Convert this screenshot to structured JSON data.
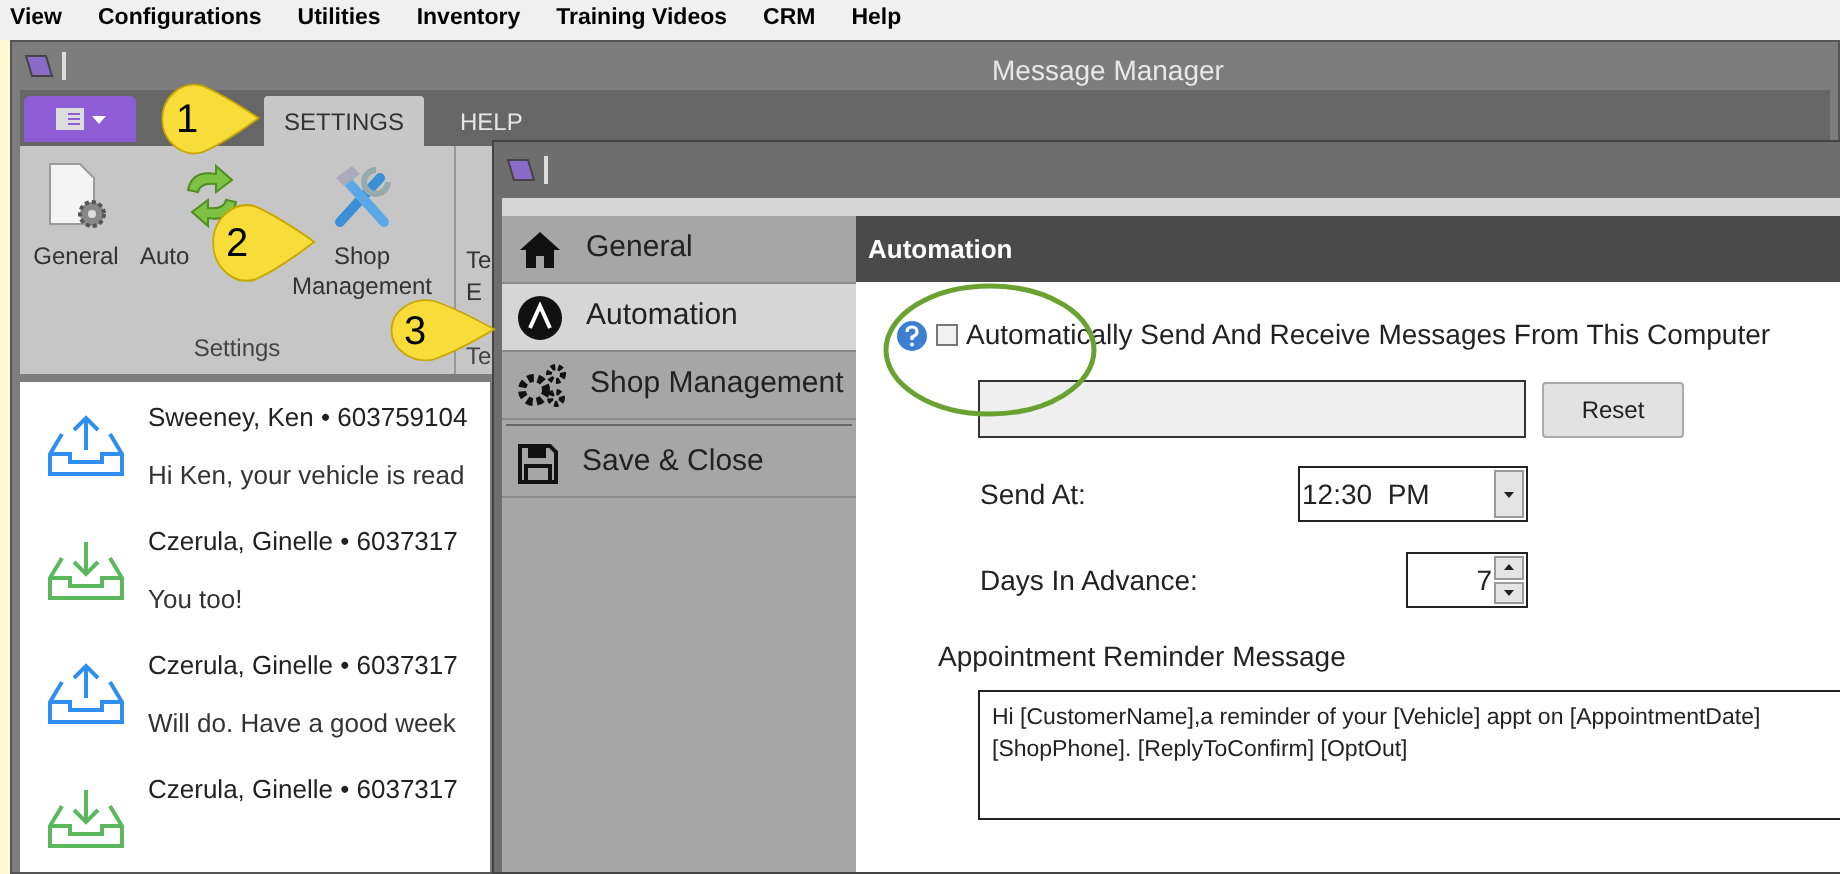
{
  "menu_bar": [
    "View",
    "Configurations",
    "Utilities",
    "Inventory",
    "Training Videos",
    "CRM",
    "Help"
  ],
  "main_window": {
    "title": "Message Manager",
    "ribbon_tabs": [
      {
        "label": "SETTINGS",
        "selected": true
      },
      {
        "label": "HELP",
        "selected": false
      }
    ],
    "ribbon_buttons": [
      {
        "kind": "general",
        "lines": [
          "General"
        ]
      },
      {
        "kind": "automation",
        "lines": [
          "Auto"
        ]
      },
      {
        "kind": "shop",
        "lines": [
          "Shop",
          "Management"
        ]
      },
      {
        "kind": "cut",
        "lines": [
          "Te",
          "E"
        ]
      }
    ],
    "ribbon_groups": [
      "Settings",
      "Te"
    ],
    "messages": [
      {
        "kind": "sent",
        "sender": "Sweeney, Ken • 603759104",
        "text": "Hi Ken, your vehicle is read"
      },
      {
        "kind": "received",
        "sender": "Czerula, Ginelle • 6037317",
        "text": "You too!"
      },
      {
        "kind": "sent",
        "sender": "Czerula, Ginelle • 6037317",
        "text": "Will do. Have a good week"
      },
      {
        "kind": "received",
        "sender": "Czerula, Ginelle • 6037317"
      }
    ]
  },
  "callouts": [
    "1",
    "2",
    "3"
  ],
  "settings_window": {
    "nav": [
      {
        "kind": "home",
        "label": "General",
        "selected": false
      },
      {
        "kind": "automation",
        "label": "Automation",
        "selected": true
      },
      {
        "kind": "gears",
        "label": "Shop Management",
        "selected": false
      },
      {
        "kind": "save",
        "label": "Save & Close",
        "selected": false
      }
    ],
    "header": "Automation",
    "auto_checkbox": {
      "label": "Automatically Send And Receive Messages From This Computer",
      "checked": false
    },
    "reset_button": "Reset",
    "send_at": {
      "label": "Send At:",
      "value": "12:30  PM"
    },
    "days_in_advance": {
      "label": "Days In Advance:",
      "value": "7"
    },
    "reminder": {
      "label": "Appointment Reminder Message",
      "lines": [
        "Hi [CustomerName],a reminder of your [Vehicle] appt on [AppointmentDate]",
        "[ShopPhone]. [ReplyToConfirm] [OptOut]"
      ]
    }
  }
}
